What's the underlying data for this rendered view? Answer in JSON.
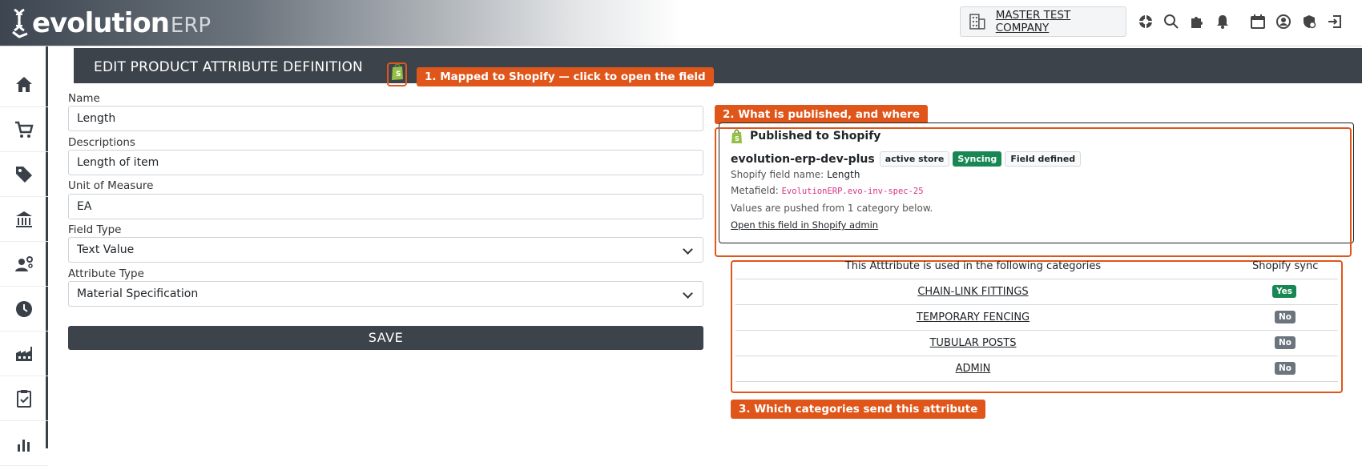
{
  "brand": {
    "name_main": "evolution",
    "name_suffix": "ERP"
  },
  "topbar": {
    "company": "MASTER TEST COMPANY"
  },
  "page": {
    "title": "EDIT PRODUCT ATTRIBUTE DEFINITION"
  },
  "callouts": {
    "one": "1. Mapped to Shopify — click to open the field",
    "two": "2. What is published, and where",
    "three": "3. Which categories send this attribute"
  },
  "form": {
    "name_label": "Name",
    "name_value": "Length",
    "desc_label": "Descriptions",
    "desc_value": "Length of item",
    "uom_label": "Unit of Measure",
    "uom_value": "EA",
    "field_type_label": "Field Type",
    "field_type_value": "Text Value",
    "attr_type_label": "Attribute Type",
    "attr_type_value": "Material Specification",
    "save_label": "SAVE"
  },
  "published": {
    "title": "Published to Shopify",
    "store": "evolution-erp-dev-plus",
    "badges": [
      "active store",
      "Syncing",
      "Field defined"
    ],
    "field_name_label": "Shopify field name:",
    "field_name_value": "Length",
    "metafield_label": "Metafield:",
    "metafield_value": "EvolutionERP.evo-inv-spec-25",
    "note": "Values are pushed from 1 category below.",
    "link": "Open this field in Shopify admin"
  },
  "categories": {
    "header_name": "This Atttribute is used in the following categories",
    "header_sync": "Shopify sync",
    "rows": [
      {
        "name": "CHAIN-LINK FITTINGS",
        "sync": "Yes"
      },
      {
        "name": "TEMPORARY FENCING",
        "sync": "No"
      },
      {
        "name": "TUBULAR POSTS",
        "sync": "No"
      },
      {
        "name": "ADMIN",
        "sync": "No"
      }
    ]
  },
  "colors": {
    "accent": "#e0561a",
    "dark": "#3d434b",
    "success": "#198754",
    "muted": "#6c757d"
  }
}
